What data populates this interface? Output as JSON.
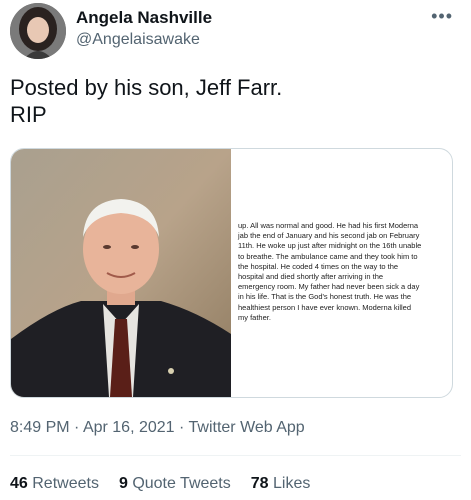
{
  "user": {
    "display_name": "Angela Nashville",
    "handle": "@Angelaisawake"
  },
  "more_icon": "more-horizontal-icon",
  "tweet": {
    "text_line1": "Posted by his son, Jeff Farr.",
    "text_line2": "RIP"
  },
  "media": {
    "caption_lines": [
      "up. All was normal and good. He had his first Moderna",
      "jab the end of January and his second jab on February",
      "11th. He woke up just after midnight on the 16th unable",
      "to breathe. The ambulance came and they took him to",
      "the hospital. He coded 4 times on the way to the",
      "hospital and died shortly after arriving in the",
      "emergency room. My father had never been sick a day",
      "in his life. That is the God's honest truth. He was the",
      "healthiest person I have ever known. Moderna killed",
      "my father."
    ]
  },
  "meta": {
    "time": "8:49 PM",
    "sep1": " · ",
    "date": "Apr 16, 2021",
    "sep2": " · ",
    "source": "Twitter Web App"
  },
  "stats": {
    "retweets_count": "46",
    "retweets_label": "Retweets",
    "quotes_count": "9",
    "quotes_label": "Quote Tweets",
    "likes_count": "78",
    "likes_label": "Likes"
  },
  "colors": {
    "text_primary": "#0f1419",
    "text_secondary": "#536471",
    "border": "#cfd9de"
  }
}
